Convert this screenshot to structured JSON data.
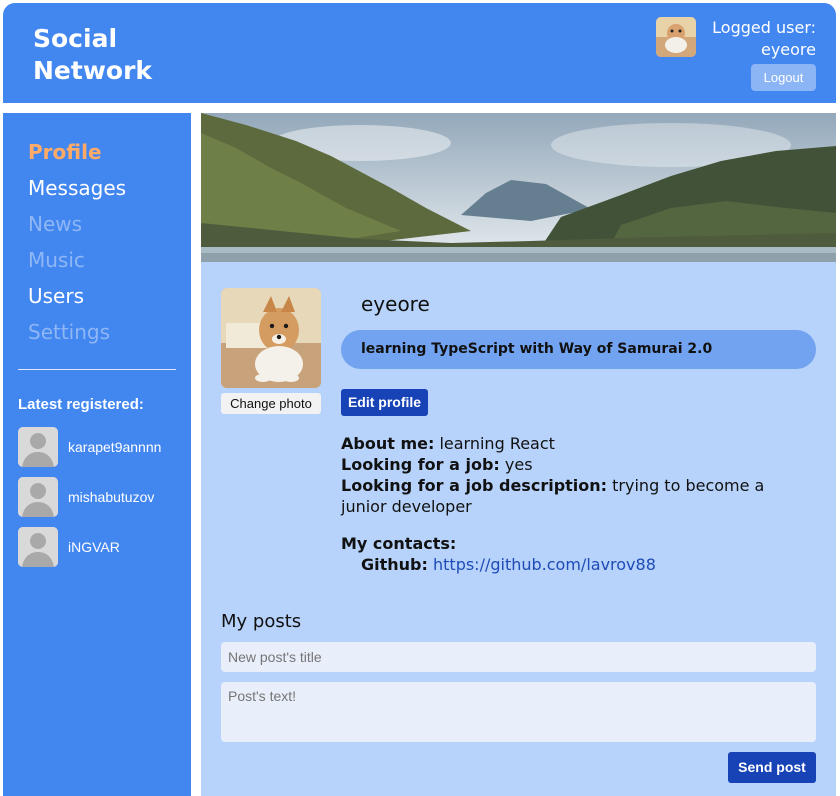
{
  "header": {
    "logo_line1": "Social",
    "logo_line2": "Network",
    "logged_user_label": "Logged user:",
    "username": "eyeore",
    "logout_label": "Logout"
  },
  "sidebar": {
    "nav": [
      {
        "label": "Profile",
        "state": "active"
      },
      {
        "label": "Messages",
        "state": "enabled"
      },
      {
        "label": "News",
        "state": "disabled"
      },
      {
        "label": "Music",
        "state": "disabled"
      },
      {
        "label": "Users",
        "state": "enabled"
      },
      {
        "label": "Settings",
        "state": "disabled"
      }
    ],
    "latest_title": "Latest registered:",
    "latest_users": [
      {
        "name": "karapet9annnn"
      },
      {
        "name": "mishabutuzov"
      },
      {
        "name": "iNGVAR"
      }
    ]
  },
  "profile": {
    "name": "eyeore",
    "status": "learning TypeScript with Way of Samurai 2.0",
    "change_photo_label": "Change photo",
    "edit_profile_label": "Edit profile",
    "about_label": "About me:",
    "about_value": "learning React",
    "job_label": "Looking for a job:",
    "job_value": "yes",
    "job_desc_label": "Looking for a job description:",
    "job_desc_value": "trying to become a junior developer",
    "contacts_label": "My contacts:",
    "github_label": "Github:",
    "github_value": "https://github.com/lavrov88"
  },
  "posts": {
    "title": "My posts",
    "title_placeholder": "New post's title",
    "text_placeholder": "Post's text!",
    "send_label": "Send post"
  }
}
